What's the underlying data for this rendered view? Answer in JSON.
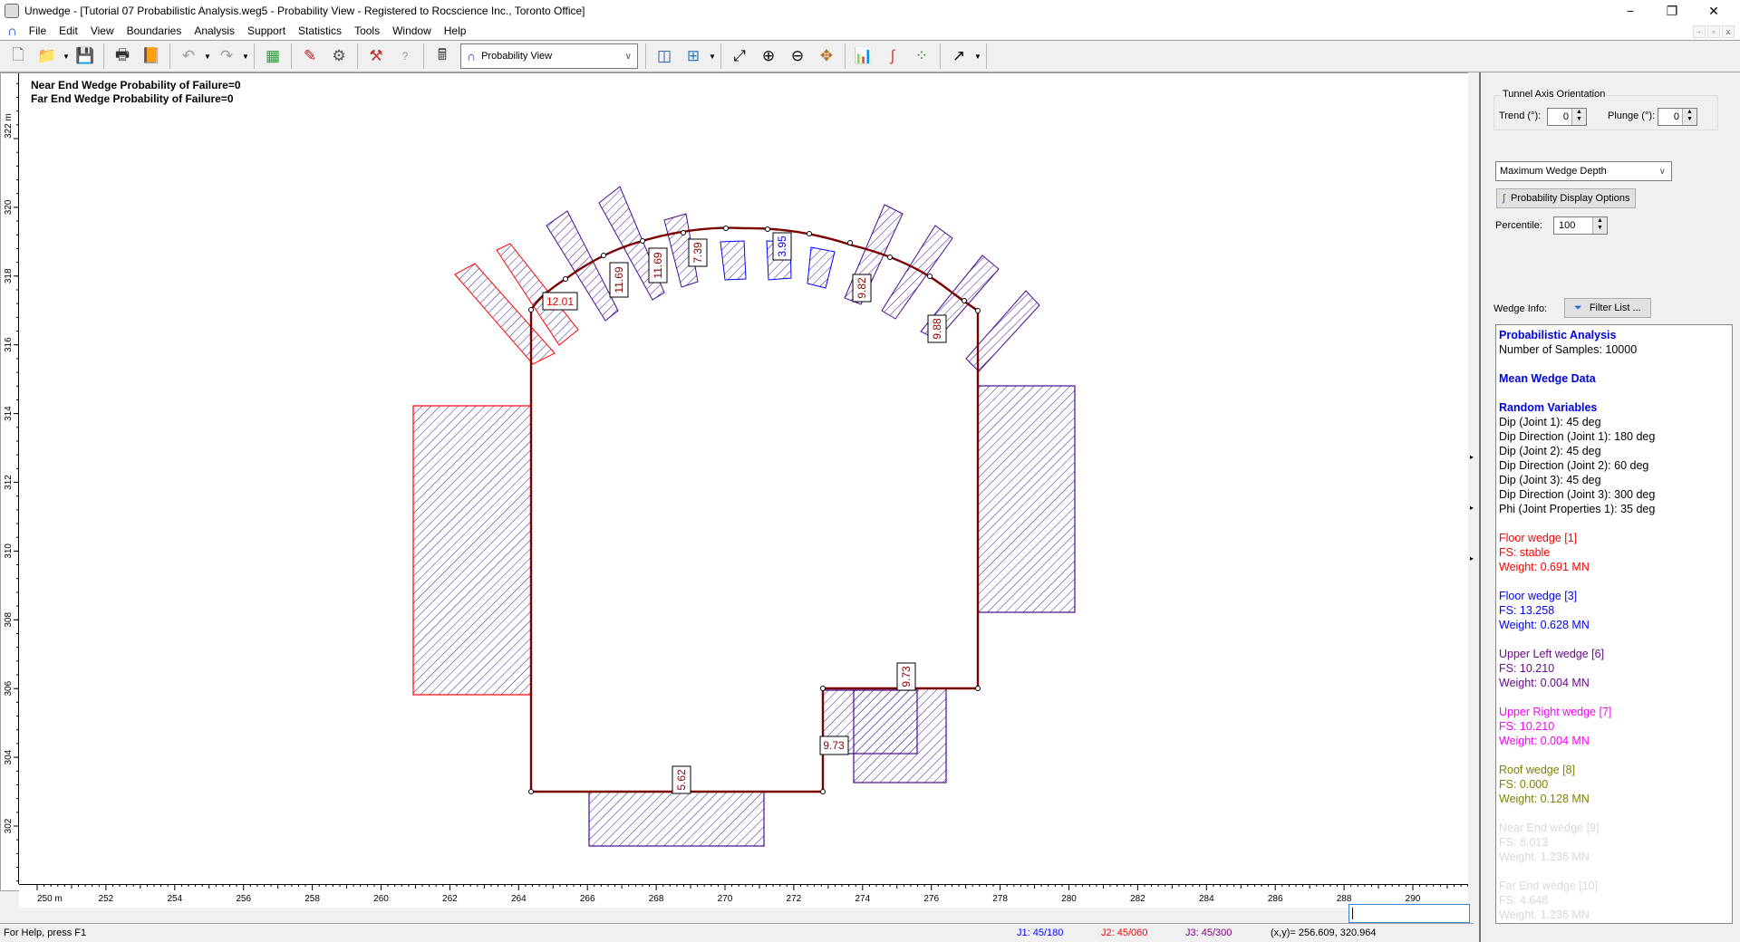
{
  "window": {
    "title": "Unwedge - [Tutorial 07 Probabilistic Analysis.weg5 - Probability View - Registered to Rocscience Inc., Toronto Office]",
    "controls": {
      "minimize": "−",
      "restore": "❐",
      "close": "✕"
    },
    "mdi_controls": {
      "minimize": "-",
      "restore": "▫",
      "close": "x"
    }
  },
  "menu": {
    "logo": "∩",
    "items": [
      "File",
      "Edit",
      "View",
      "Boundaries",
      "Analysis",
      "Support",
      "Statistics",
      "Tools",
      "Window",
      "Help"
    ]
  },
  "toolbar": {
    "view_select": {
      "icon": "∩",
      "value": "Probability View"
    },
    "icons": {
      "new": "🗋",
      "open": "📁",
      "save": "💾",
      "print": "🖶",
      "export": "📙",
      "undo": "↶",
      "redo": "↷",
      "colors": "▦",
      "edit": "✎",
      "settings": "⚙",
      "compute": "⚒",
      "info": "?",
      "calc": "🖩",
      "tile": "◫",
      "add_view": "⊞",
      "zoom_all": "⤢",
      "zoom_in": "⊕",
      "zoom_out": "⊖",
      "pan": "✥",
      "histogram": "📊",
      "cumulative": "∫",
      "scatter": "⁘",
      "arrow": "↗"
    }
  },
  "canvas": {
    "probability_text": [
      "Near End Wedge Probability of Failure=0",
      "Far End Wedge Probability of Failure=0"
    ],
    "x_axis": {
      "unit": "m",
      "ticks": [
        250,
        252,
        254,
        256,
        258,
        260,
        262,
        264,
        266,
        268,
        270,
        272,
        274,
        276,
        278,
        280,
        282,
        284,
        286,
        288,
        290
      ]
    },
    "y_axis": {
      "unit": "m",
      "ticks": [
        302,
        304,
        306,
        308,
        310,
        312,
        314,
        316,
        318,
        320,
        322
      ]
    },
    "depth_labels": {
      "left_roof_start": "12.01",
      "roof_1": "11.69",
      "roof_2": "11.69",
      "roof_3": "7.39",
      "roof_crown": "3.95",
      "roof_right_1": "9.82",
      "roof_right_2": "9.88",
      "floor": "5.62",
      "step_wall": "9.73",
      "step_top": "9.73"
    },
    "colors": {
      "boundary": "#7a0000",
      "floor_wedge_1": "#ff0000",
      "floor_wedge_3": "#0000ff",
      "upper_left_wedge": "#5a0a8c",
      "upper_right_wedge": "#ff00ff",
      "roof_wedge": "#808000",
      "hatch": "#3a1aa0"
    }
  },
  "side_panel": {
    "tunnel_axis": {
      "legend": "Tunnel Axis Orientation",
      "trend_label": "Trend (°):",
      "trend_value": "0",
      "plunge_label": "Plunge (°):",
      "plunge_value": "0"
    },
    "display_select": "Maximum Wedge Depth",
    "prob_display_button": "Probability Display Options",
    "percentile_label": "Percentile:",
    "percentile_value": "100",
    "wedge_info_label": "Wedge Info:",
    "filter_button": "Filter List ...",
    "info": {
      "heading1": "Probabilistic Analysis",
      "samples": "Number of Samples: 10000",
      "heading2": "Mean Wedge Data",
      "heading3": "Random Variables",
      "variables": [
        "Dip (Joint 1): 45 deg",
        "Dip Direction (Joint 1): 180 deg",
        "Dip (Joint 2): 45 deg",
        "Dip Direction (Joint 2): 60 deg",
        "Dip (Joint 3): 45 deg",
        "Dip Direction (Joint 3): 300 deg",
        "Phi (Joint Properties 1): 35 deg"
      ],
      "wedges": [
        {
          "name": "Floor wedge [1]",
          "fs": "FS: stable",
          "weight": "Weight: 0.691 MN",
          "color": "#ff0000"
        },
        {
          "name": "Floor wedge [3]",
          "fs": "FS: 13.258",
          "weight": "Weight: 0.628 MN",
          "color": "#0000ff"
        },
        {
          "name": "Upper Left wedge [6]",
          "fs": "FS: 10.210",
          "weight": "Weight: 0.004 MN",
          "color": "#6a0a8c"
        },
        {
          "name": "Upper Right wedge [7]",
          "fs": "FS: 10.210",
          "weight": "Weight: 0.004 MN",
          "color": "#ff00ff"
        },
        {
          "name": "Roof wedge [8]",
          "fs": "FS: 0.000",
          "weight": "Weight: 0.128 MN",
          "color": "#808000"
        },
        {
          "name": "Near End wedge [9]",
          "fs": "FS: 8.013",
          "weight": "Weight: 1.236 MN",
          "color": "#d8d8d8"
        },
        {
          "name": "Far End wedge [10]",
          "fs": "FS: 4.648",
          "weight": "Weight: 1.236 MN",
          "color": "#d8d8d8"
        }
      ]
    }
  },
  "statusbar": {
    "help": "For Help, press F1",
    "j1": "J1: 45/180",
    "j2": "J2: 45/060",
    "j3": "J3: 45/300",
    "coords": "(x,y)= 256.609, 320.964",
    "j1_color": "#0000ff",
    "j2_color": "#ff0000",
    "j3_color": "#800080"
  }
}
